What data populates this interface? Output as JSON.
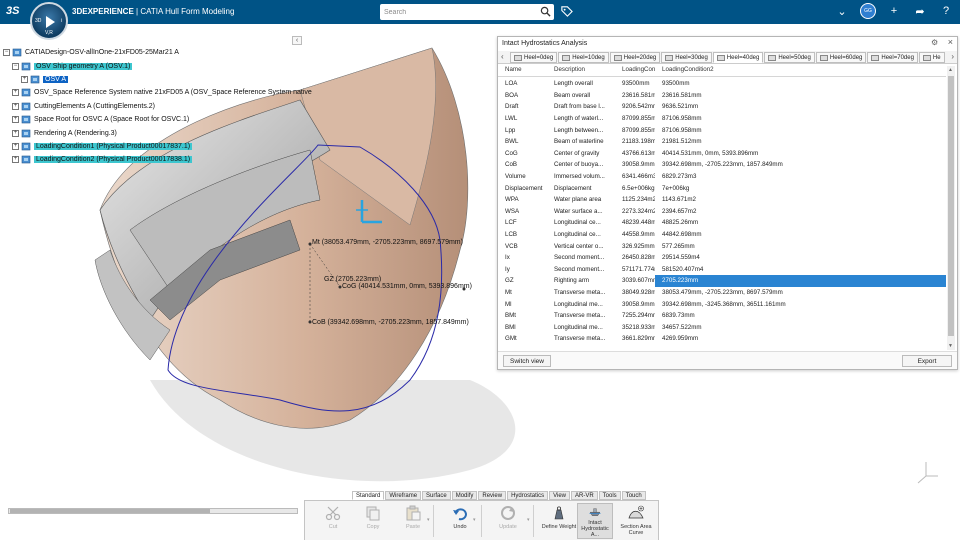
{
  "topbar": {
    "logo": "3S",
    "brand": "3DEXPERIENCE",
    "title_rest": " | CATIA Hull Form Modeling",
    "compass": {
      "left": "3D",
      "right": "i",
      "bottom": "V,R"
    },
    "search_placeholder": "Search",
    "avatar_initials": "GG"
  },
  "tree": {
    "collapse_glyph": "‹",
    "items": [
      {
        "label": "CATIADesign-OSV-allInOne-21xFD05-25Mar21 A",
        "indent": 0,
        "expander": "−",
        "style": "normal"
      },
      {
        "label": "OSV Ship geometry A (OSV.1)",
        "indent": 1,
        "expander": "−",
        "style": "highlight"
      },
      {
        "label": "OSV A",
        "indent": 2,
        "expander": "+",
        "style": "selected"
      },
      {
        "label": "OSV_Space Reference System native 21xFD05 A (OSV_Space Reference System native",
        "indent": 1,
        "expander": "+",
        "style": "normal"
      },
      {
        "label": "CuttingElements A (CuttingElements.2)",
        "indent": 1,
        "expander": "+",
        "style": "normal"
      },
      {
        "label": "Space Root for OSVC A (Space Root for OSVC.1)",
        "indent": 1,
        "expander": "+",
        "style": "normal"
      },
      {
        "label": "Rendering A (Rendering.3)",
        "indent": 1,
        "expander": "+",
        "style": "normal"
      },
      {
        "label": "LoadingCondition1 (Physical Product00017837.1)",
        "indent": 1,
        "expander": "+",
        "style": "highlight"
      },
      {
        "label": "LoadingCondition2 (Physical Product00017838.1)",
        "indent": 1,
        "expander": "+",
        "style": "highlight"
      }
    ]
  },
  "annotations": {
    "mt": "Mt (38053.479mm, -2705.223mm, 8697.579mm)",
    "gz": "GZ (2705.223mm)",
    "cog": "CoG (40414.531mm, 0mm, 5393.896mm)",
    "cob": "CoB (39342.698mm, -2705.223mm, 1857.849mm)"
  },
  "hydro": {
    "title": "Intact Hydrostatics Analysis",
    "tabs": [
      "Heel=0deg",
      "Heel=10deg",
      "Heel=20deg",
      "Heel=30deg",
      "Heel=40deg",
      "Heel=50deg",
      "Heel=60deg",
      "Heel=70deg",
      "He"
    ],
    "active_tab": 4,
    "columns": [
      "Name",
      "Description",
      "LoadingConditi...",
      "LoadingCondition2"
    ],
    "rows": [
      [
        "LOA",
        "Length overall",
        "93500mm",
        "93500mm"
      ],
      [
        "BOA",
        "Beam overall",
        "23616.581mm",
        "23616.581mm"
      ],
      [
        "Draft",
        "Draft from base l...",
        "9206.542mm",
        "9636.521mm"
      ],
      [
        "LWL",
        "Length of waterl...",
        "87099.855mm",
        "87106.958mm"
      ],
      [
        "Lpp",
        "Length between...",
        "87099.855mm",
        "87106.958mm"
      ],
      [
        "BWL",
        "Beam of waterline",
        "21183.198mm",
        "21981.512mm"
      ],
      [
        "CoG",
        "Center of gravity",
        "43766.613mm, 0...",
        "40414.531mm, 0mm, 5393.896mm"
      ],
      [
        "CoB",
        "Center of buoya...",
        "39058.9mm, -303...",
        "39342.698mm, -2705.223mm, 1857.849mm"
      ],
      [
        "Volume",
        "Immersed volum...",
        "6341.466m3",
        "6829.273m3"
      ],
      [
        "Displacement",
        "Displacement",
        "6.5e+006kg",
        "7e+006kg"
      ],
      [
        "WPA",
        "Water plane area",
        "1125.234m2",
        "1143.671m2"
      ],
      [
        "WSA",
        "Water surface a...",
        "2273.324m2",
        "2394.657m2"
      ],
      [
        "LCF",
        "Longitudinal ce...",
        "48239.448mm",
        "48825.26mm"
      ],
      [
        "LCB",
        "Longitudinal ce...",
        "44558.9mm",
        "44842.698mm"
      ],
      [
        "VCB",
        "Vertical center o...",
        "326.925mm",
        "577.265mm"
      ],
      [
        "Ix",
        "Second moment...",
        "26450.828m4",
        "29514.559m4"
      ],
      [
        "Iy",
        "Second moment...",
        "571171.774m4",
        "581520.407m4"
      ],
      [
        "GZ",
        "Righting arm",
        "3039.607mm",
        "2705.223mm"
      ],
      [
        "Mt",
        "Transverse meta...",
        "38049.928mm, -...",
        "38053.479mm, -2705.223mm, 8697.579mm"
      ],
      [
        "Ml",
        "Longitudinal me...",
        "39058.9mm, -347...",
        "39342.698mm, -3245.368mm, 36511.161mm"
      ],
      [
        "BMt",
        "Transverse meta...",
        "7255.294mm",
        "6839.73mm"
      ],
      [
        "BMl",
        "Longitudinal me...",
        "35218.933mm",
        "34657.522mm"
      ],
      [
        "GMt",
        "Transverse meta...",
        "3661.829mm",
        "4269.959mm"
      ]
    ],
    "selected_row": 17,
    "switch_label": "Switch view",
    "export_label": "Export"
  },
  "action_bar": {
    "tabs": [
      "Standard",
      "Wireframe",
      "Surface",
      "Modify",
      "Review",
      "Hydrostatics",
      "View",
      "AR-VR",
      "Tools",
      "Touch"
    ],
    "active_tab": 0,
    "commands": [
      {
        "label": "Cut",
        "icon": "scissors-icon",
        "enabled": false
      },
      {
        "label": "Copy",
        "icon": "copy-icon",
        "enabled": false
      },
      {
        "label": "Paste",
        "icon": "paste-icon",
        "enabled": false
      },
      {
        "label": "Undo",
        "icon": "undo-icon",
        "enabled": true
      },
      {
        "label": "Update",
        "icon": "update-icon",
        "enabled": false
      },
      {
        "label": "Define Weight",
        "icon": "weight-icon",
        "enabled": true
      },
      {
        "label": "Intact Hydrostatic A...",
        "icon": "hydrostatic-icon",
        "enabled": true
      },
      {
        "label": "Section Area Curve",
        "icon": "section-curve-icon",
        "enabled": true
      }
    ]
  },
  "colors": {
    "topbar": "#005386",
    "tree_highlight": "#3dc6cf",
    "selection": "#2a84d2",
    "hull": "#d9b9a4",
    "waterline": "#2a2aa8"
  }
}
